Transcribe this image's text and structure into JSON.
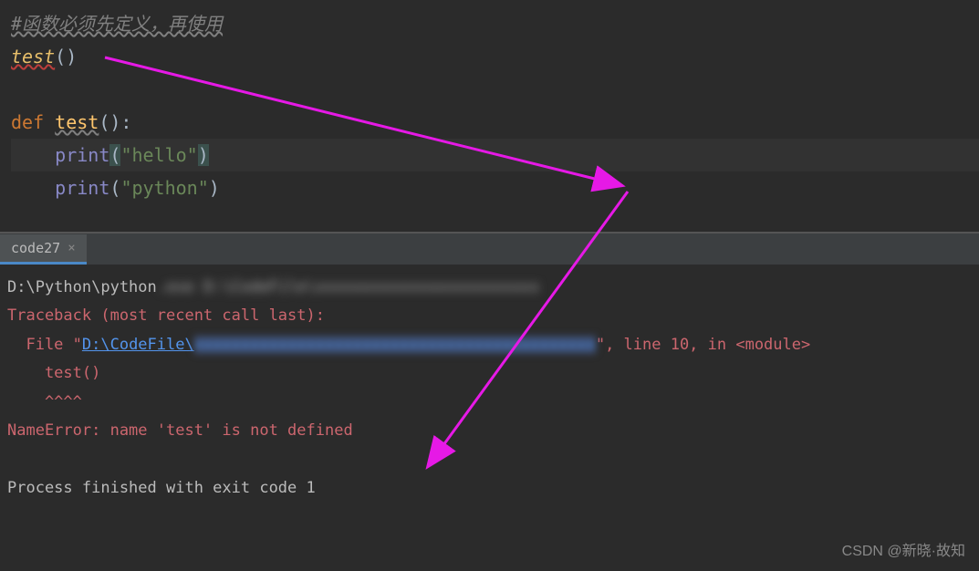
{
  "editor": {
    "comment": "#函数必须先定义，再使用",
    "call_line": {
      "func": "test",
      "parens": "()"
    },
    "def_line": {
      "keyword": "def ",
      "name": "test",
      "parens": "():"
    },
    "print1": {
      "builtin": "print",
      "open": "(",
      "string": "\"hello\"",
      "close": ")"
    },
    "print2": {
      "builtin": "print",
      "open": "(",
      "string": "\"python\"",
      "close": ")"
    }
  },
  "tab": {
    "label": "code27",
    "close": "×"
  },
  "console": {
    "path_prefix": "D:\\Python\\python",
    "path_blur": ".exe D:\\CodeFile\\xxxxxxxxxxxxxxxxxxxxxxxx",
    "traceback": "Traceback (most recent call last):",
    "file_label": "  File \"",
    "file_link": "D:\\CodeFile\\",
    "file_blur": "xxxxxxxxxxxxxxxxxxxxxxxxxxxxxxxxxxxxxxxxxxx",
    "file_suffix": "\", line 10, in <module>",
    "test_call": "    test()",
    "carets": "    ^^^^",
    "error": "NameError: name 'test' is not defined",
    "process": "Process finished with exit code 1"
  },
  "watermark": "CSDN @新晓·故知"
}
